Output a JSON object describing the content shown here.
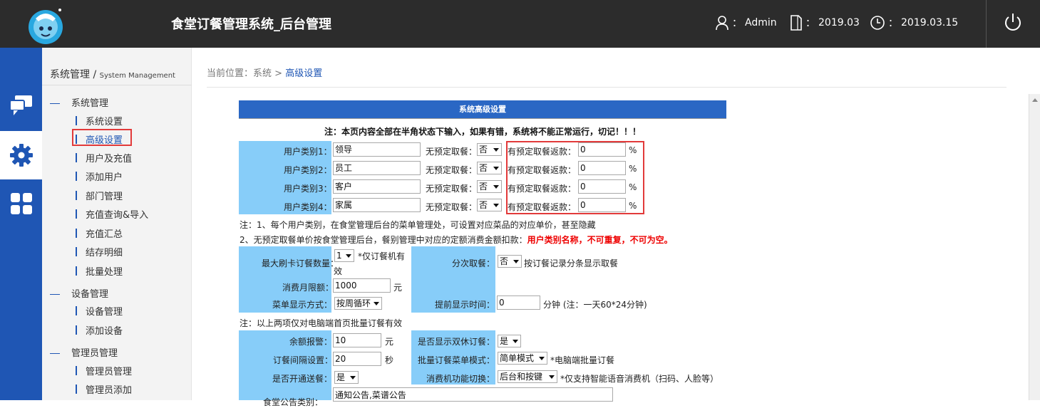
{
  "app": {
    "title": "食堂订餐管理系统_后台管理",
    "user_prefix": "：",
    "user": "Admin",
    "period_prefix": "：",
    "period": "2019.03",
    "date_prefix": "：",
    "date": "2019.03.15"
  },
  "rail": [
    {
      "icon": "chat-icon",
      "active": false
    },
    {
      "icon": "gear-icon",
      "active": true
    },
    {
      "icon": "grid-icon",
      "active": false
    }
  ],
  "sidenav": {
    "title": "系统管理",
    "title_sep": "/",
    "subtitle": "System Management",
    "groups": [
      {
        "label": "系统管理",
        "items": [
          "系统设置",
          "高级设置",
          "用户及充值",
          "添加用户",
          "部门管理",
          "充值查询&导入",
          "充值汇总",
          "结存明细",
          "批量处理"
        ]
      },
      {
        "label": "设备管理",
        "items": [
          "设备管理",
          "添加设备"
        ]
      },
      {
        "label": "管理员管理",
        "items": [
          "管理员管理",
          "管理员添加"
        ]
      }
    ]
  },
  "breadcrumb": {
    "prefix": "当前位置：系统",
    "sep": ">",
    "current": "高级设置"
  },
  "form": {
    "header": "系统高级设置",
    "warning": "注：本页内容全部在半角状态下输入，如果有错，系统将不能正常运行，切记！！！",
    "user_types": [
      {
        "label": "用户类别1：",
        "value": "领导",
        "no_book_label": "无预定取餐：",
        "no_book_value": "否",
        "refund_label": "有预定取餐返款：",
        "refund_value": "0",
        "unit": "%"
      },
      {
        "label": "用户类别2：",
        "value": "员工",
        "no_book_label": "无预定取餐：",
        "no_book_value": "否",
        "refund_label": "有预定取餐返款：",
        "refund_value": "0",
        "unit": "%"
      },
      {
        "label": "用户类别3：",
        "value": "客户",
        "no_book_label": "无预定取餐：",
        "no_book_value": "否",
        "refund_label": "有预定取餐返款：",
        "refund_value": "0",
        "unit": "%"
      },
      {
        "label": "用户类别4：",
        "value": "家属",
        "no_book_label": "无预定取餐：",
        "no_book_value": "否",
        "refund_label": "有预定取餐返款：",
        "refund_value": "0",
        "unit": "%"
      }
    ],
    "note1": "注：1、每个用户类别，在食堂管理后台的菜单管理处，可设置对应菜品的对应单价，甚至隐藏",
    "note2": "2、无预定取餐单价按食堂管理后台，餐别管理中对应的定额消费金额扣款：",
    "note2_red": "用户类别名称，不可重复，不可为空。",
    "max_card_label": "最大刷卡订餐数量：",
    "max_card_value": "1",
    "max_card_note1": "*仅订餐机有",
    "max_card_note2": "效",
    "split_label": "分次取餐：",
    "split_value": "否",
    "split_note": "按订餐记录分条显示取餐",
    "monthly_label": "消费月限额：",
    "monthly_value": "1000",
    "monthly_unit": "元",
    "menu_mode_label": "菜单显示方式：",
    "menu_mode_value": "按周循环",
    "advance_label": "提前显示时间：",
    "advance_value": "0",
    "advance_note": "分钟 (注：一天60*24分钟)",
    "note3": "注：以上两项仅对电脑端首页批量订餐有效",
    "balance_label": "余额报警：",
    "balance_value": "10",
    "balance_unit": "元",
    "weekend_label": "是否显示双休订餐：",
    "weekend_value": "是",
    "interval_label": "订餐间隔设置：",
    "interval_value": "20",
    "interval_unit": "秒",
    "batch_label": "批量订餐菜单模式：",
    "batch_value": "简单模式",
    "batch_note": "*电脑端批量订餐",
    "delivery_label": "是否开通送餐：",
    "delivery_value": "是",
    "switch_label": "消费机功能切换：",
    "switch_value": "后台和按键",
    "switch_note": "*仅支持智能语音消费机（扫码、人脸等）",
    "notice_label": "食堂公告类别：",
    "notice_value": "通知公告,菜谱公告"
  }
}
